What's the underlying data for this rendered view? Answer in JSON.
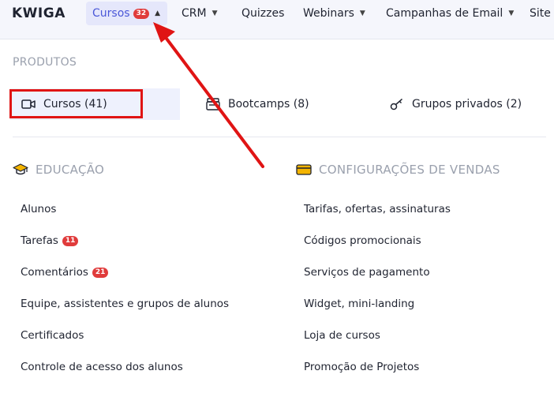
{
  "header": {
    "logo": "KWIGA",
    "nav": [
      {
        "label": "Cursos",
        "badge": "32",
        "active": true
      },
      {
        "label": "CRM"
      },
      {
        "label": "Quizzes"
      },
      {
        "label": "Webinars"
      },
      {
        "label": "Campanhas de Email"
      },
      {
        "label": "Site"
      }
    ]
  },
  "menu": {
    "section_title": "PRODUTOS",
    "products": [
      {
        "label": "Cursos (41)",
        "icon": "video-icon",
        "active": true
      },
      {
        "label": "Bootcamps (8)",
        "icon": "bootcamp-icon"
      },
      {
        "label": "Grupos privados (2)",
        "icon": "key-icon"
      }
    ],
    "education": {
      "title": "EDUCAÇÃO",
      "items": [
        {
          "label": "Alunos"
        },
        {
          "label": "Tarefas",
          "badge": "11"
        },
        {
          "label": "Comentários",
          "badge": "21"
        },
        {
          "label": "Equipe, assistentes e grupos de alunos"
        },
        {
          "label": "Certificados"
        },
        {
          "label": "Controle de acesso dos alunos"
        }
      ]
    },
    "sales": {
      "title": "CONFIGURAÇÕES DE VENDAS",
      "items": [
        {
          "label": "Tarifas, ofertas, assinaturas"
        },
        {
          "label": "Códigos promocionais"
        },
        {
          "label": "Serviços de pagamento"
        },
        {
          "label": "Widget, mini-landing"
        },
        {
          "label": "Loja de cursos"
        },
        {
          "label": "Promoção de Projetos"
        }
      ]
    }
  },
  "colors": {
    "accent": "#4a57d8",
    "badge": "#e03b3b",
    "annotation": "#e01414",
    "muted_heading": "#9aa0ad"
  }
}
